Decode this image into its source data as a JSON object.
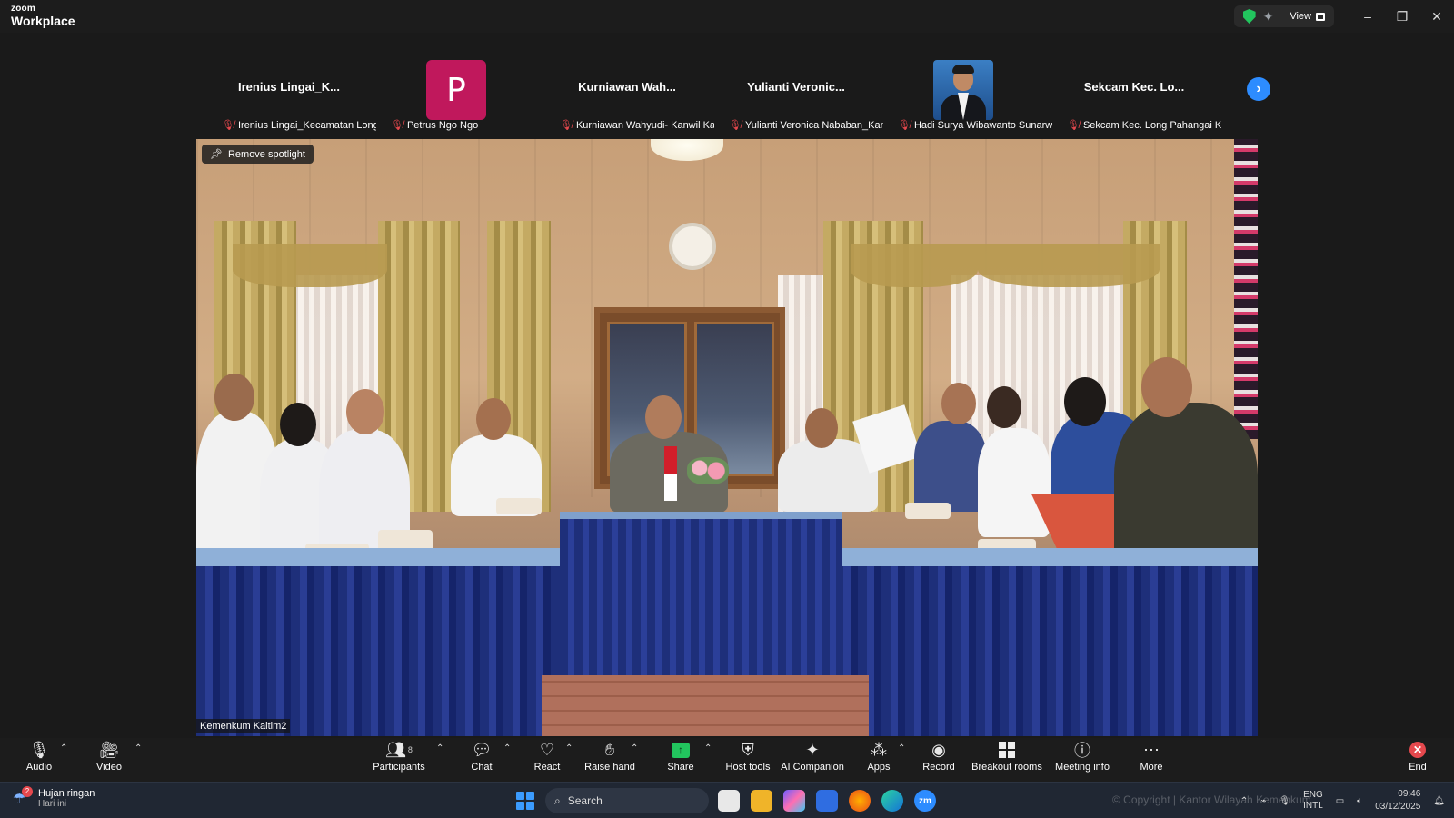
{
  "app": {
    "brand_small": "zoom",
    "brand_name": "Workplace"
  },
  "titlebar": {
    "view_label": "View",
    "controls": [
      "–",
      "❐",
      "✕"
    ]
  },
  "participants_strip": [
    {
      "display": "Irenius  Lingai_K...",
      "label": "Irenius Lingai_Kecamatan Long P...",
      "kind": "name"
    },
    {
      "display": "P",
      "label": "Petrus Ngo Ngo",
      "kind": "initial",
      "color": "#c0185c"
    },
    {
      "display": "Kurniawan  Wah...",
      "label": "Kurniawan Wahyudi- Kanwil Kaltim",
      "kind": "name"
    },
    {
      "display": "Yulianti  Veronic...",
      "label": "Yulianti Veronica Nababan_Kanw...",
      "kind": "name"
    },
    {
      "display": "",
      "label": "Hadi Surya Wibawanto Sunarwadi",
      "kind": "photo"
    },
    {
      "display": "Sekcam  Kec.  Lo...",
      "label": "Sekcam Kec. Long Pahangai Kab...",
      "kind": "name"
    }
  ],
  "main_video": {
    "spotlight_label": "Remove spotlight",
    "speaker_label": "Kemenkum Kaltim2"
  },
  "toolbar": {
    "audio": "Audio",
    "video": "Video",
    "participants": "Participants",
    "participants_count": "8",
    "chat": "Chat",
    "react": "React",
    "raise_hand": "Raise hand",
    "share": "Share",
    "host_tools": "Host tools",
    "ai_companion": "AI Companion",
    "apps": "Apps",
    "record": "Record",
    "breakout": "Breakout rooms",
    "meeting_info": "Meeting info",
    "more": "More",
    "end": "End"
  },
  "taskbar": {
    "weather_title": "Hujan ringan",
    "weather_sub": "Hari ini",
    "weather_badge": "2",
    "search_placeholder": "Search",
    "lang_top": "ENG",
    "lang_bottom": "INTL",
    "time": "09:46",
    "date": "03/12/2025",
    "watermark": "© Copyright | Kantor Wilayah Kemenkum"
  },
  "colors": {
    "accent": "#2d8cff",
    "share": "#22c55e",
    "end": "#e5484d",
    "muted": "#e5484d"
  }
}
